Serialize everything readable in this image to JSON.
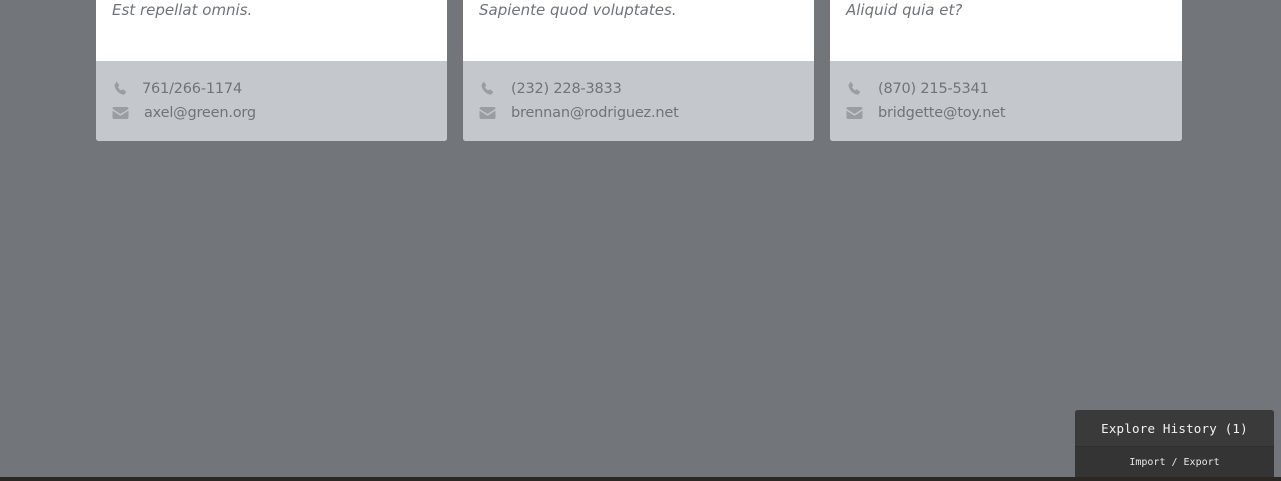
{
  "cards": [
    {
      "quote": "Est repellat omnis.",
      "phone": "761/266-1174",
      "email": "axel@green.org"
    },
    {
      "quote": "Sapiente quod voluptates.",
      "phone": "(232) 228-3833",
      "email": "brennan@rodriguez.net"
    },
    {
      "quote": "Aliquid quia et?",
      "phone": "(870) 215-5341",
      "email": "bridgette@toy.net"
    }
  ],
  "icons": {
    "phone": "phone-icon",
    "email": "envelope-icon"
  },
  "history": {
    "title": "Explore History (1)",
    "import_export": "Import / Export"
  },
  "colors": {
    "overlay": "#727579",
    "card_footer": "#c4c8cc",
    "panel": "#363636"
  }
}
